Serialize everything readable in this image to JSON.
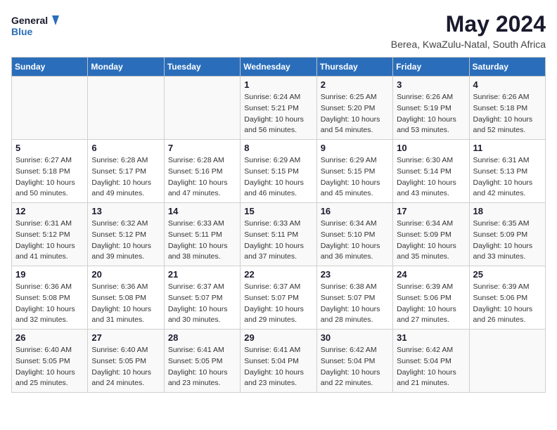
{
  "logo": {
    "line1": "General",
    "line2": "Blue"
  },
  "title": "May 2024",
  "subtitle": "Berea, KwaZulu-Natal, South Africa",
  "headers": [
    "Sunday",
    "Monday",
    "Tuesday",
    "Wednesday",
    "Thursday",
    "Friday",
    "Saturday"
  ],
  "weeks": [
    [
      {
        "day": "",
        "info": ""
      },
      {
        "day": "",
        "info": ""
      },
      {
        "day": "",
        "info": ""
      },
      {
        "day": "1",
        "info": "Sunrise: 6:24 AM\nSunset: 5:21 PM\nDaylight: 10 hours\nand 56 minutes."
      },
      {
        "day": "2",
        "info": "Sunrise: 6:25 AM\nSunset: 5:20 PM\nDaylight: 10 hours\nand 54 minutes."
      },
      {
        "day": "3",
        "info": "Sunrise: 6:26 AM\nSunset: 5:19 PM\nDaylight: 10 hours\nand 53 minutes."
      },
      {
        "day": "4",
        "info": "Sunrise: 6:26 AM\nSunset: 5:18 PM\nDaylight: 10 hours\nand 52 minutes."
      }
    ],
    [
      {
        "day": "5",
        "info": "Sunrise: 6:27 AM\nSunset: 5:18 PM\nDaylight: 10 hours\nand 50 minutes."
      },
      {
        "day": "6",
        "info": "Sunrise: 6:28 AM\nSunset: 5:17 PM\nDaylight: 10 hours\nand 49 minutes."
      },
      {
        "day": "7",
        "info": "Sunrise: 6:28 AM\nSunset: 5:16 PM\nDaylight: 10 hours\nand 47 minutes."
      },
      {
        "day": "8",
        "info": "Sunrise: 6:29 AM\nSunset: 5:15 PM\nDaylight: 10 hours\nand 46 minutes."
      },
      {
        "day": "9",
        "info": "Sunrise: 6:29 AM\nSunset: 5:15 PM\nDaylight: 10 hours\nand 45 minutes."
      },
      {
        "day": "10",
        "info": "Sunrise: 6:30 AM\nSunset: 5:14 PM\nDaylight: 10 hours\nand 43 minutes."
      },
      {
        "day": "11",
        "info": "Sunrise: 6:31 AM\nSunset: 5:13 PM\nDaylight: 10 hours\nand 42 minutes."
      }
    ],
    [
      {
        "day": "12",
        "info": "Sunrise: 6:31 AM\nSunset: 5:12 PM\nDaylight: 10 hours\nand 41 minutes."
      },
      {
        "day": "13",
        "info": "Sunrise: 6:32 AM\nSunset: 5:12 PM\nDaylight: 10 hours\nand 39 minutes."
      },
      {
        "day": "14",
        "info": "Sunrise: 6:33 AM\nSunset: 5:11 PM\nDaylight: 10 hours\nand 38 minutes."
      },
      {
        "day": "15",
        "info": "Sunrise: 6:33 AM\nSunset: 5:11 PM\nDaylight: 10 hours\nand 37 minutes."
      },
      {
        "day": "16",
        "info": "Sunrise: 6:34 AM\nSunset: 5:10 PM\nDaylight: 10 hours\nand 36 minutes."
      },
      {
        "day": "17",
        "info": "Sunrise: 6:34 AM\nSunset: 5:09 PM\nDaylight: 10 hours\nand 35 minutes."
      },
      {
        "day": "18",
        "info": "Sunrise: 6:35 AM\nSunset: 5:09 PM\nDaylight: 10 hours\nand 33 minutes."
      }
    ],
    [
      {
        "day": "19",
        "info": "Sunrise: 6:36 AM\nSunset: 5:08 PM\nDaylight: 10 hours\nand 32 minutes."
      },
      {
        "day": "20",
        "info": "Sunrise: 6:36 AM\nSunset: 5:08 PM\nDaylight: 10 hours\nand 31 minutes."
      },
      {
        "day": "21",
        "info": "Sunrise: 6:37 AM\nSunset: 5:07 PM\nDaylight: 10 hours\nand 30 minutes."
      },
      {
        "day": "22",
        "info": "Sunrise: 6:37 AM\nSunset: 5:07 PM\nDaylight: 10 hours\nand 29 minutes."
      },
      {
        "day": "23",
        "info": "Sunrise: 6:38 AM\nSunset: 5:07 PM\nDaylight: 10 hours\nand 28 minutes."
      },
      {
        "day": "24",
        "info": "Sunrise: 6:39 AM\nSunset: 5:06 PM\nDaylight: 10 hours\nand 27 minutes."
      },
      {
        "day": "25",
        "info": "Sunrise: 6:39 AM\nSunset: 5:06 PM\nDaylight: 10 hours\nand 26 minutes."
      }
    ],
    [
      {
        "day": "26",
        "info": "Sunrise: 6:40 AM\nSunset: 5:05 PM\nDaylight: 10 hours\nand 25 minutes."
      },
      {
        "day": "27",
        "info": "Sunrise: 6:40 AM\nSunset: 5:05 PM\nDaylight: 10 hours\nand 24 minutes."
      },
      {
        "day": "28",
        "info": "Sunrise: 6:41 AM\nSunset: 5:05 PM\nDaylight: 10 hours\nand 23 minutes."
      },
      {
        "day": "29",
        "info": "Sunrise: 6:41 AM\nSunset: 5:04 PM\nDaylight: 10 hours\nand 23 minutes."
      },
      {
        "day": "30",
        "info": "Sunrise: 6:42 AM\nSunset: 5:04 PM\nDaylight: 10 hours\nand 22 minutes."
      },
      {
        "day": "31",
        "info": "Sunrise: 6:42 AM\nSunset: 5:04 PM\nDaylight: 10 hours\nand 21 minutes."
      },
      {
        "day": "",
        "info": ""
      }
    ]
  ]
}
